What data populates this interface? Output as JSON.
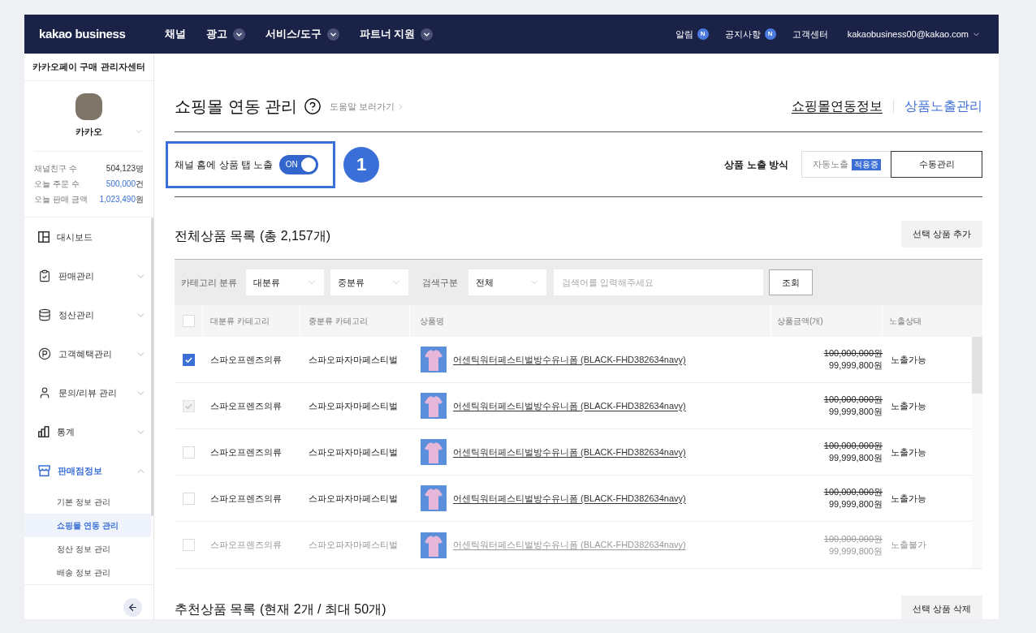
{
  "nav": {
    "logo": "kakao business",
    "menus": [
      {
        "label": "채널",
        "has_menu": false
      },
      {
        "label": "광고",
        "has_menu": true
      },
      {
        "label": "서비스/도구",
        "has_menu": true
      },
      {
        "label": "파트너 지원",
        "has_menu": true
      }
    ],
    "links": [
      {
        "label": "알림",
        "badge": "N"
      },
      {
        "label": "공지사항",
        "badge": "N"
      },
      {
        "label": "고객센터"
      }
    ],
    "account": "kakaobusiness00@kakao.com"
  },
  "sidebar": {
    "title": "카카오페이 구매 관리자센터",
    "profile": {
      "name": "카카오"
    },
    "stats": [
      {
        "label": "채널친구 수",
        "value": "504,123",
        "unit": "명",
        "highlight": false
      },
      {
        "label": "오늘 주문 수",
        "value": "500,000",
        "unit": "건",
        "highlight": true
      },
      {
        "label": "오늘 판매 금액",
        "value": "1,023,490",
        "unit": "원",
        "highlight": true
      }
    ],
    "menu": [
      {
        "label": "대시보드",
        "selected": false
      },
      {
        "label": "판매관리",
        "expanded": false,
        "selected": false
      },
      {
        "label": "정산관리",
        "expanded": false,
        "selected": false
      },
      {
        "label": "고객혜택관리",
        "expanded": false,
        "selected": false
      },
      {
        "label": "문의/리뷰 관리",
        "expanded": false,
        "selected": false
      },
      {
        "label": "통계",
        "expanded": false,
        "selected": false
      },
      {
        "label": "판매점정보",
        "expanded": true,
        "selected": true,
        "children": [
          {
            "label": "기본 정보 관리",
            "selected": false
          },
          {
            "label": "쇼핑몰 연동 관리",
            "selected": true
          },
          {
            "label": "정산 정보 관리",
            "selected": false
          },
          {
            "label": "배송 정보 관리",
            "selected": false
          }
        ]
      }
    ]
  },
  "page": {
    "title": "쇼핑몰 연동 관리",
    "help_link": "도움말 보러가기",
    "tabs": [
      {
        "label": "쇼핑몰연동정보",
        "selected": false
      },
      {
        "label": "상품노출관리",
        "selected": true
      }
    ]
  },
  "exposure": {
    "label": "채널 홈에 상품 탭 노출",
    "toggle": {
      "on": true,
      "label": "ON"
    },
    "step": "1",
    "mode_label": "상품 노출 방식",
    "modes": [
      {
        "label": "자동노출",
        "badge": "적용중",
        "selected": false
      },
      {
        "label": "수동관리",
        "selected": true
      }
    ]
  },
  "products": {
    "title": "전체상품 목록 (총 2,157개)",
    "add_button": "선택 상품 추가",
    "filters": {
      "category_label": "카테고리 분류",
      "category_selects": [
        "대분류",
        "중분류"
      ],
      "search_label": "검색구분",
      "search_type": "전체",
      "search_placeholder": "검색어를 입력해주세요",
      "search_button": "조회"
    },
    "header_checked": false,
    "columns": [
      "대분류 카테고리",
      "중분류 카테고리",
      "상품명",
      "상품금액(개)",
      "노출상태"
    ],
    "rows": [
      {
        "checked": true,
        "checkbox_disabled": false,
        "disabled": false,
        "major": "스파오프렌즈의류",
        "minor": "스파오파자마페스티벌",
        "name": "어센틱워터페스티벌방수유니폼 (BLACK-FHD382634navy)",
        "original_price": "100,000,000원",
        "price": "99,999,800원",
        "status": "노출가능"
      },
      {
        "checked": true,
        "checkbox_disabled": true,
        "disabled": false,
        "major": "스파오프렌즈의류",
        "minor": "스파오파자마페스티벌",
        "name": "어센틱워터페스티벌방수유니폼 (BLACK-FHD382634navy)",
        "original_price": "100,000,000원",
        "price": "99,999,800원",
        "status": "노출가능"
      },
      {
        "checked": false,
        "checkbox_disabled": false,
        "disabled": false,
        "major": "스파오프렌즈의류",
        "minor": "스파오파자마페스티벌",
        "name": "어센틱워터페스티벌방수유니폼 (BLACK-FHD382634navy)",
        "original_price": "100,000,000원",
        "price": "99,999,800원",
        "status": "노출가능"
      },
      {
        "checked": false,
        "checkbox_disabled": false,
        "disabled": false,
        "major": "스파오프렌즈의류",
        "minor": "스파오파자마페스티벌",
        "name": "어센틱워터페스티벌방수유니폼 (BLACK-FHD382634navy)",
        "original_price": "100,000,000원",
        "price": "99,999,800원",
        "status": "노출가능"
      },
      {
        "checked": false,
        "checkbox_disabled": false,
        "disabled": true,
        "major": "스파오프렌즈의류",
        "minor": "스파오파자마페스티벌",
        "name": "어센틱워터페스티벌방수유니폼 (BLACK-FHD382634navy)",
        "original_price": "100,000,000원",
        "price": "99,999,800원",
        "status": "노출불가"
      }
    ]
  },
  "recommended": {
    "title": "추천상품 목록 (현재 2개 / 최대 50개)",
    "delete_button": "선택 상품 삭제"
  }
}
